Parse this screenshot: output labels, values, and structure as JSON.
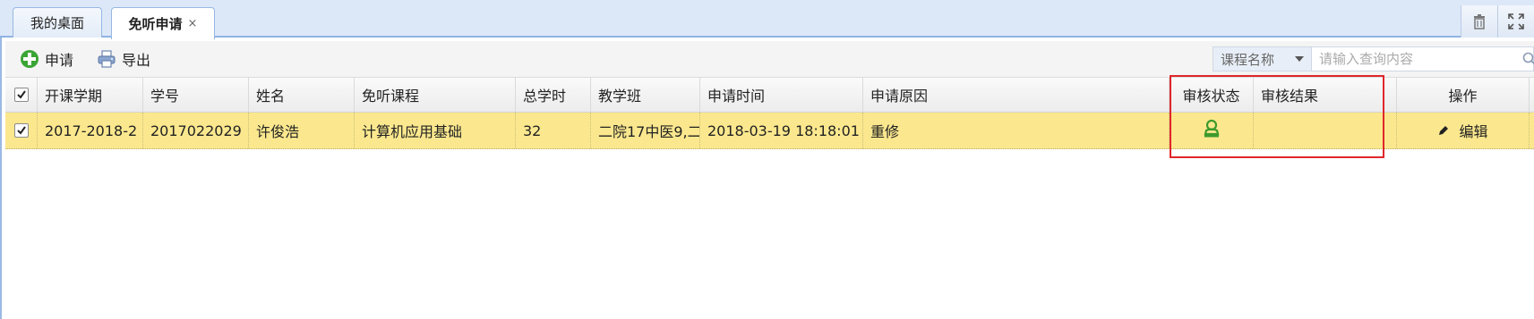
{
  "tabs": {
    "items": [
      {
        "label": "我的桌面"
      },
      {
        "label": "免听申请",
        "close": "×"
      }
    ]
  },
  "tab_tools": {
    "icons": [
      "trash-icon",
      "fullscreen-icon"
    ]
  },
  "toolbar": {
    "apply_label": "申请",
    "export_label": "导出",
    "search_select_value": "课程名称",
    "search_placeholder": "请输入查询内容"
  },
  "grid": {
    "columns": [
      "开课学期",
      "学号",
      "姓名",
      "免听课程",
      "总学时",
      "教学班",
      "申请时间",
      "申请原因",
      "审核状态",
      "审核结果",
      "操作"
    ],
    "rows": [
      {
        "semester": "2017-2018-2",
        "student_id": "2017022029",
        "name": "许俊浩",
        "course": "计算机应用基础",
        "hours": "32",
        "class": "二院17中医9,二",
        "time": "2018-03-19 18:18:01",
        "reason": "重修",
        "status_icon": "user-stamp-icon",
        "result": "",
        "edit_label": "编辑"
      }
    ]
  },
  "colors": {
    "tab_bg": "#dce8f8",
    "selected_row": "#fbe88e",
    "highlight": "#e0262b",
    "status_icon": "#3c9a2c"
  }
}
